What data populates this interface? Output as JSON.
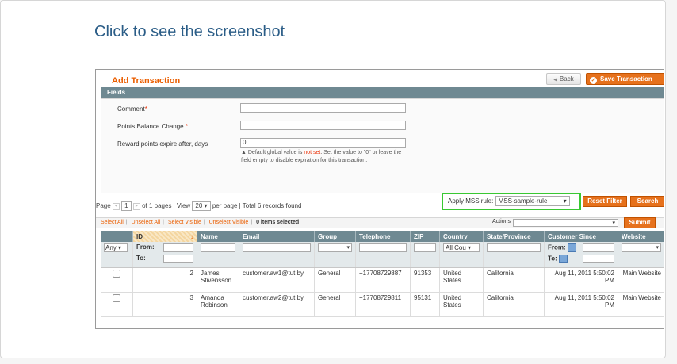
{
  "caption": "Click to see the screenshot",
  "page": {
    "title": "Add Transaction",
    "back_label": "Back",
    "save_label": "Save Transaction",
    "save_check": "✓",
    "back_arrow": "◀"
  },
  "fieldset": {
    "title": "Fields",
    "comment_label": "Comment",
    "points_label": "Points Balance Change",
    "expire_label": "Reward points expire after, days",
    "required_mark": "*",
    "expire_value": "0",
    "note_prefix": "Default global value is ",
    "note_link": "not set",
    "note_suffix": ". Set the value to \"0\" or leave the field empty to disable expiration for this transaction."
  },
  "pager": {
    "page_label": "Page",
    "page_value": "1",
    "of_pages": "of 1 pages",
    "view_label": "View",
    "view_value": "20",
    "per_page": "per page",
    "total": "Total 6 records found"
  },
  "mss": {
    "label": "Apply MSS rule:",
    "value": "MSS-sample-rule"
  },
  "buttons": {
    "reset_filter": "Reset Filter",
    "search": "Search",
    "submit": "Submit"
  },
  "massaction": {
    "select_all": "Select All",
    "unselect_all": "Unselect All",
    "select_visible": "Select Visible",
    "unselect_visible": "Unselect Visible",
    "selected": "0 items selected",
    "actions_label": "Actions"
  },
  "grid": {
    "columns": [
      "ID",
      "Name",
      "Email",
      "Group",
      "Telephone",
      "ZIP",
      "Country",
      "State/Province",
      "Customer Since",
      "Website"
    ],
    "sort_arrow": "↓",
    "filter": {
      "any": "Any",
      "from": "From:",
      "to": "To:",
      "country": "All Cou"
    },
    "rows": [
      {
        "id": "2",
        "name": "James Stivensson",
        "email": "customer.aw1@tut.by",
        "group": "General",
        "telephone": "+17708729887",
        "zip": "91353",
        "country": "United States",
        "state": "California",
        "since": "Aug 11, 2011 5:50:02 PM",
        "website": "Main Website"
      },
      {
        "id": "3",
        "name": "Amanda Robinson",
        "email": "customer.aw2@tut.by",
        "group": "General",
        "telephone": "+17708729811",
        "zip": "95131",
        "country": "United States",
        "state": "California",
        "since": "Aug 11, 2011 5:50:02 PM",
        "website": "Main Website"
      }
    ]
  },
  "colors": {
    "accent": "#eb5e00",
    "header": "#6f8992",
    "highlight": "#39c832",
    "link": "#2b5d87"
  }
}
